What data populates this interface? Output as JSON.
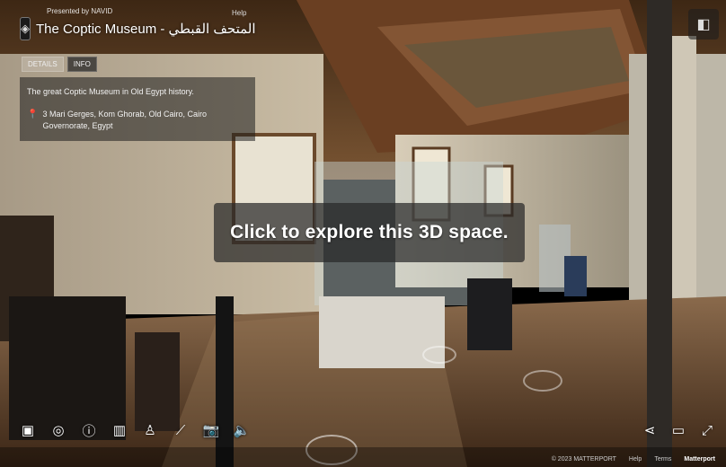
{
  "header": {
    "presented_by": "Presented by NAVID",
    "title": "The Coptic Museum - المتحف القبطي",
    "help": "Help"
  },
  "tabs": [
    {
      "label": "DETAILS"
    },
    {
      "label": "INFO"
    }
  ],
  "details": {
    "description": "The great Coptic Museum in Old Egypt history.",
    "address": "3 Mari Gerges, Kom Ghorab, Old Cairo, Cairo Governorate, Egypt"
  },
  "cta": {
    "label": "Click to explore this 3D space."
  },
  "toolbar": {
    "items": [
      {
        "icon": "dollhouse-icon"
      },
      {
        "icon": "target-icon"
      },
      {
        "icon": "info-icon"
      },
      {
        "icon": "floor-plan-icon"
      },
      {
        "icon": "person-icon"
      },
      {
        "icon": "measure-icon"
      },
      {
        "icon": "camera-icon"
      },
      {
        "icon": "sound-icon"
      }
    ]
  },
  "right_tools": [
    {
      "icon": "share-icon"
    },
    {
      "icon": "vr-icon"
    },
    {
      "icon": "fullscreen-icon"
    }
  ],
  "footer": {
    "links": [
      "© 2023 MATTERPORT",
      "Help",
      "Terms"
    ],
    "brand": "Matterport"
  },
  "colors": {
    "overlay": "#2a2a2a",
    "text": "#ffffff",
    "floor": "#6b4a30",
    "ceiling": "#5a3b22"
  }
}
